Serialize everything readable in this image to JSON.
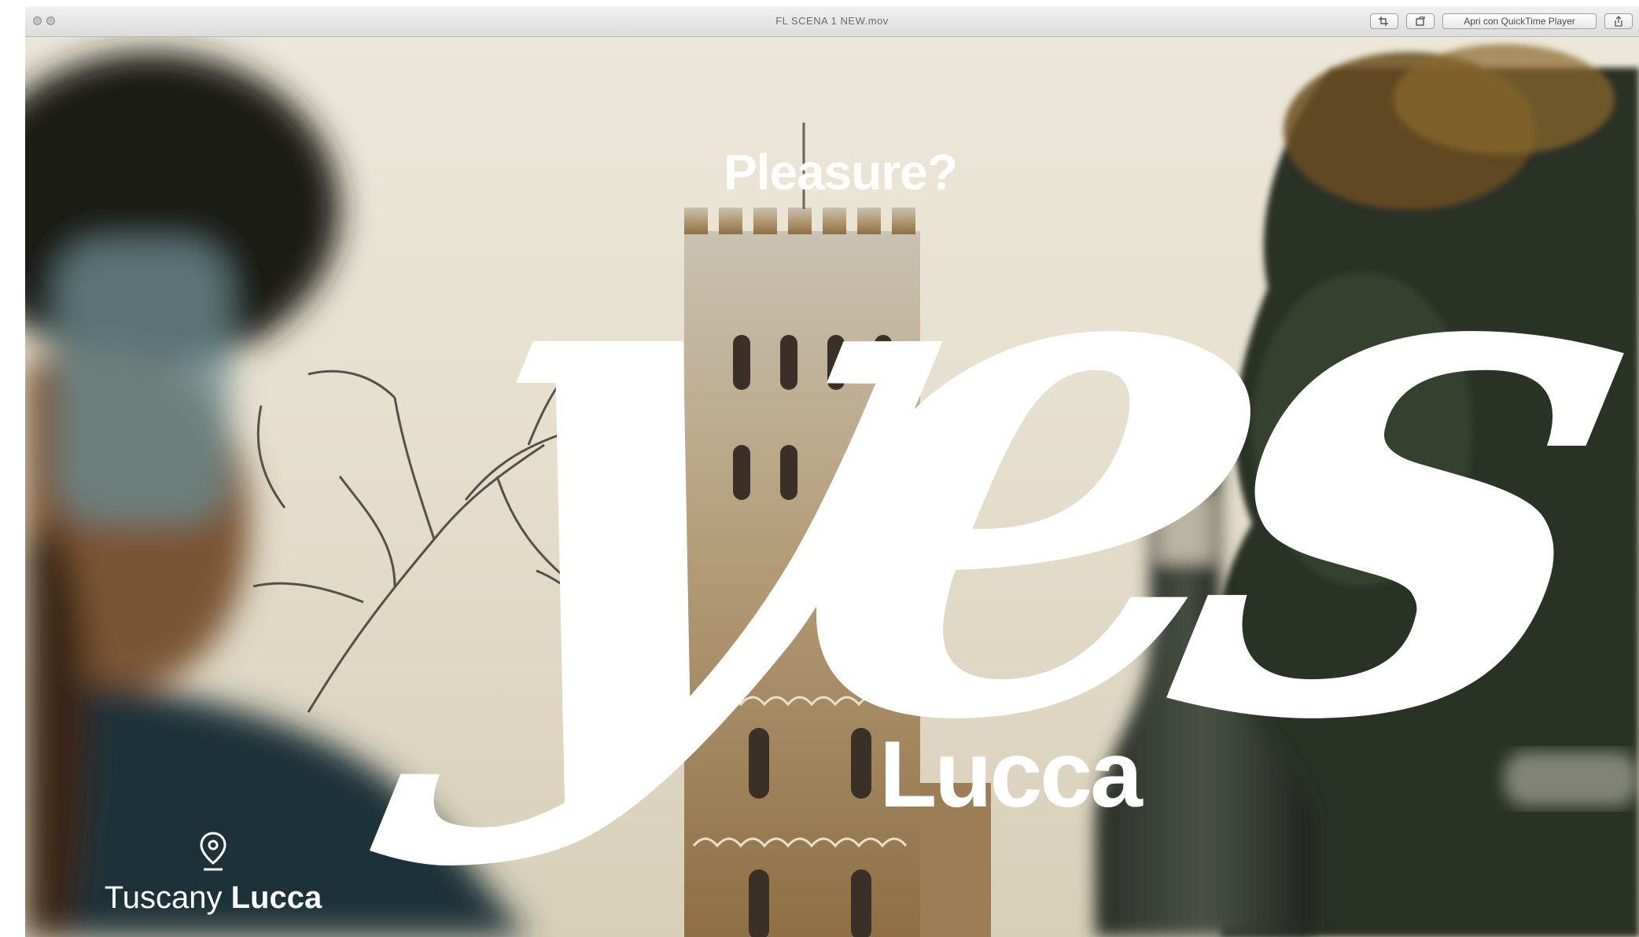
{
  "window": {
    "title": "FL SCENA 1 NEW.mov",
    "buttons": {
      "trim": "trim-icon",
      "rotate": "rotate-icon",
      "open_with": "Apri con QuickTime Player",
      "share": "share-icon"
    }
  },
  "video": {
    "headline_top": "Pleasure?",
    "script_word": "yes",
    "headline_bottom": "Lucca",
    "location_region": "Tuscany",
    "location_city": "Lucca",
    "location_icon": "map-pin-icon"
  },
  "colors": {
    "overlay_text": "#ffffff",
    "sky": "#e8e3d4",
    "tower_stone": "#a98d63",
    "foliage": "#2c3226"
  }
}
